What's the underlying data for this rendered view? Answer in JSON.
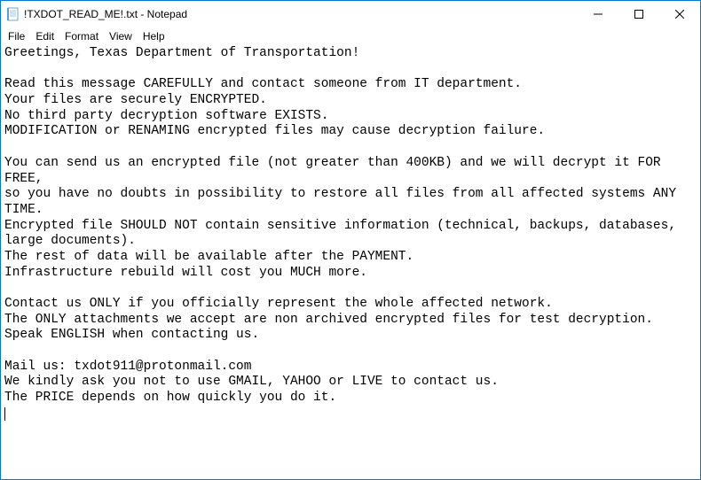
{
  "window": {
    "title": "!TXDOT_READ_ME!.txt - Notepad"
  },
  "menubar": {
    "file": "File",
    "edit": "Edit",
    "format": "Format",
    "view": "View",
    "help": "Help"
  },
  "document": {
    "content": "Greetings, Texas Department of Transportation!\n\nRead this message CAREFULLY and contact someone from IT department.\nYour files are securely ENCRYPTED.\nNo third party decryption software EXISTS.\nMODIFICATION or RENAMING encrypted files may cause decryption failure.\n\nYou can send us an encrypted file (not greater than 400KB) and we will decrypt it FOR FREE,\nso you have no doubts in possibility to restore all files from all affected systems ANY TIME.\nEncrypted file SHOULD NOT contain sensitive information (technical, backups, databases, large documents).\nThe rest of data will be available after the PAYMENT.\nInfrastructure rebuild will cost you MUCH more.\n\nContact us ONLY if you officially represent the whole affected network.\nThe ONLY attachments we accept are non archived encrypted files for test decryption.\nSpeak ENGLISH when contacting us.\n\nMail us: txdot911@protonmail.com\nWe kindly ask you not to use GMAIL, YAHOO or LIVE to contact us.\nThe PRICE depends on how quickly you do it."
  },
  "icons": {
    "app": "notepad-icon",
    "minimize": "minimize-icon",
    "maximize": "maximize-icon",
    "close": "close-icon"
  }
}
